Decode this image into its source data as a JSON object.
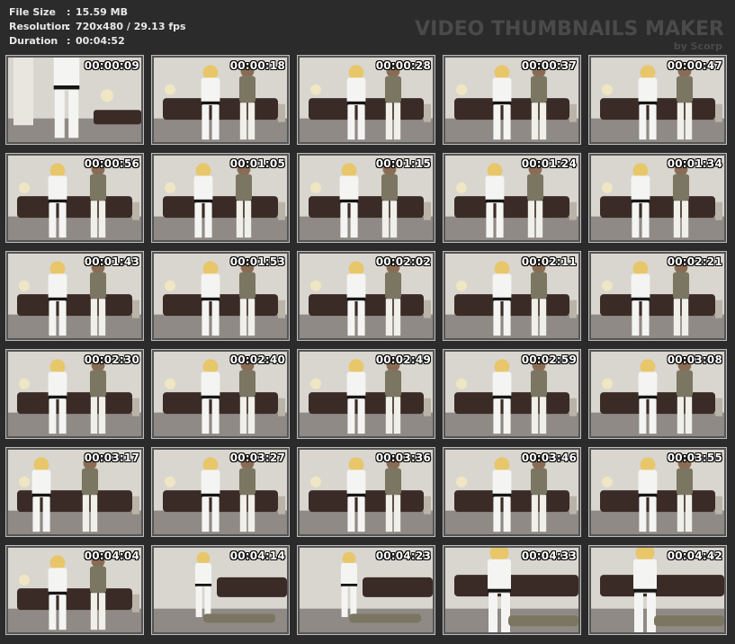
{
  "info": {
    "file_size_label": "File Size",
    "file_size_value": "15.59 MB",
    "resolution_label": "Resolution",
    "resolution_value": "720x480 / 29.13 fps",
    "duration_label": "Duration",
    "duration_value": "00:04:52",
    "separator": ":"
  },
  "brand": {
    "title": "VIDEO THUMBNAILS MAKER",
    "subtitle": "by Scorp"
  },
  "thumbnails": [
    {
      "time": "00:00:09",
      "scene": "a"
    },
    {
      "time": "00:00:18",
      "scene": "b"
    },
    {
      "time": "00:00:28",
      "scene": "b"
    },
    {
      "time": "00:00:37",
      "scene": "b"
    },
    {
      "time": "00:00:47",
      "scene": "b"
    },
    {
      "time": "00:00:56",
      "scene": "c"
    },
    {
      "time": "00:01:05",
      "scene": "c"
    },
    {
      "time": "00:01:15",
      "scene": "c"
    },
    {
      "time": "00:01:24",
      "scene": "c"
    },
    {
      "time": "00:01:34",
      "scene": "c"
    },
    {
      "time": "00:01:43",
      "scene": "c"
    },
    {
      "time": "00:01:53",
      "scene": "d"
    },
    {
      "time": "00:02:02",
      "scene": "d"
    },
    {
      "time": "00:02:11",
      "scene": "d"
    },
    {
      "time": "00:02:21",
      "scene": "c"
    },
    {
      "time": "00:02:30",
      "scene": "c"
    },
    {
      "time": "00:02:40",
      "scene": "d"
    },
    {
      "time": "00:02:49",
      "scene": "d"
    },
    {
      "time": "00:02:59",
      "scene": "d"
    },
    {
      "time": "00:03:08",
      "scene": "d"
    },
    {
      "time": "00:03:17",
      "scene": "e"
    },
    {
      "time": "00:03:27",
      "scene": "d"
    },
    {
      "time": "00:03:36",
      "scene": "d"
    },
    {
      "time": "00:03:46",
      "scene": "d"
    },
    {
      "time": "00:03:55",
      "scene": "d"
    },
    {
      "time": "00:04:04",
      "scene": "c"
    },
    {
      "time": "00:04:14",
      "scene": "f"
    },
    {
      "time": "00:04:23",
      "scene": "f"
    },
    {
      "time": "00:04:33",
      "scene": "g"
    },
    {
      "time": "00:04:42",
      "scene": "g"
    }
  ],
  "colors": {
    "background": "#2b2b2b",
    "wall": "#d9d6cf",
    "floor": "#8f8a85",
    "sofa": "#3a2b26",
    "gi": "#f4f4f2",
    "belt": "#151515",
    "hair": "#e8c66a",
    "shirt": "#7b7662",
    "pants": "#f0efe8"
  }
}
